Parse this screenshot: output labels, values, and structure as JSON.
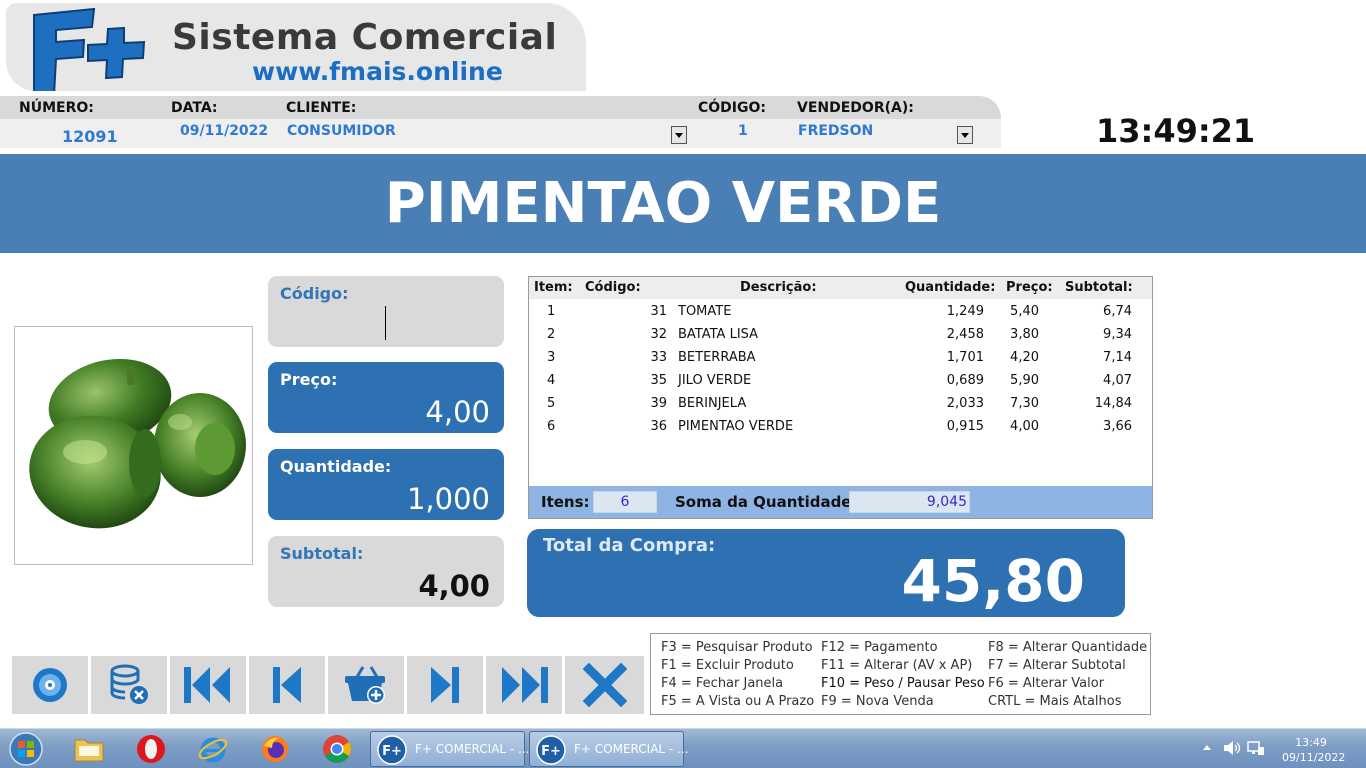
{
  "logo": {
    "mark_text": "F+",
    "title": "Sistema Comercial",
    "url": "www.fmais.online"
  },
  "header": {
    "numero_label": "NÚMERO:",
    "numero": "12091",
    "data_label": "DATA:",
    "data": "09/11/2022",
    "cliente_label": "CLIENTE:",
    "cliente": "CONSUMIDOR",
    "codigo_label": "CÓDIGO:",
    "codigo": "1",
    "vendedor_label": "VENDEDOR(A):",
    "vendedor": "FREDSON"
  },
  "clock": "13:49:21",
  "banner": {
    "product_name": "PIMENTAO VERDE"
  },
  "fields": {
    "codigo_label": "Código:",
    "codigo_value": "",
    "preco_label": "Preço:",
    "preco_value": "4,00",
    "quantidade_label": "Quantidade:",
    "quantidade_value": "1,000",
    "subtotal_label": "Subtotal:",
    "subtotal_value": "4,00"
  },
  "items": {
    "headers": {
      "item": "Item:",
      "codigo": "Código:",
      "descricao": "Descrição:",
      "quantidade": "Quantidade:",
      "preco": "Preço:",
      "subtotal": "Subtotal:"
    },
    "rows": [
      {
        "item": "1",
        "codigo": "31",
        "descricao": "TOMATE",
        "quantidade": "1,249",
        "preco": "5,40",
        "subtotal": "6,74"
      },
      {
        "item": "2",
        "codigo": "32",
        "descricao": "BATATA LISA",
        "quantidade": "2,458",
        "preco": "3,80",
        "subtotal": "9,34"
      },
      {
        "item": "3",
        "codigo": "33",
        "descricao": "BETERRABA",
        "quantidade": "1,701",
        "preco": "4,20",
        "subtotal": "7,14"
      },
      {
        "item": "4",
        "codigo": "35",
        "descricao": "JILO VERDE",
        "quantidade": "0,689",
        "preco": "5,90",
        "subtotal": "4,07"
      },
      {
        "item": "5",
        "codigo": "39",
        "descricao": "BERINJELA",
        "quantidade": "2,033",
        "preco": "7,30",
        "subtotal": "14,84"
      },
      {
        "item": "6",
        "codigo": "36",
        "descricao": "PIMENTAO VERDE",
        "quantidade": "0,915",
        "preco": "4,00",
        "subtotal": "3,66"
      }
    ],
    "footer": {
      "itens_label": "Itens:",
      "itens_value": "6",
      "soma_label": "Soma da Quantidade:",
      "soma_value": "9,045"
    }
  },
  "total": {
    "label": "Total da Compra:",
    "value": "45,80"
  },
  "toolbar": [
    {
      "icon": "disc-icon"
    },
    {
      "icon": "database-remove-icon"
    },
    {
      "icon": "first-record-icon"
    },
    {
      "icon": "previous-record-icon"
    },
    {
      "icon": "basket-add-icon"
    },
    {
      "icon": "next-record-icon"
    },
    {
      "icon": "last-record-icon"
    },
    {
      "icon": "close-icon"
    }
  ],
  "shortcuts": [
    [
      "F3 = Pesquisar Produto",
      "F12 = Pagamento",
      "F8 = Alterar Quantidade"
    ],
    [
      "F1 = Excluir Produto",
      "F11 = Alterar (AV x AP)",
      "F7 = Alterar Subtotal"
    ],
    [
      "F4 = Fechar Janela",
      "F10 = Peso / Pausar Peso",
      "F6 = Alterar Valor"
    ],
    [
      "F5 = A Vista ou A Prazo",
      "F9 = Nova Venda",
      "CRTL = Mais Atalhos"
    ]
  ],
  "taskbar": {
    "apps": [
      {
        "label": "F+ COMERCIAL - ..."
      },
      {
        "label": "F+ COMERCIAL - ..."
      }
    ],
    "time": "13:49",
    "date": "09/11/2022",
    "colors": {
      "accent": "#2d71b3",
      "banner": "#4a7fb5"
    }
  }
}
